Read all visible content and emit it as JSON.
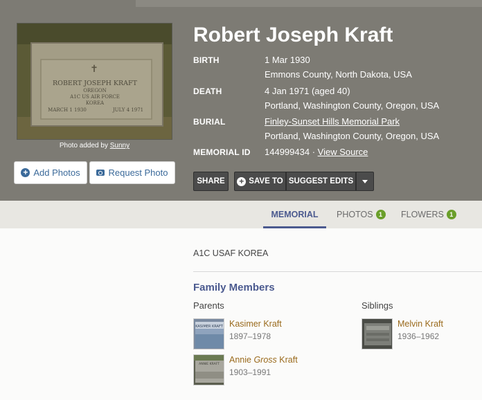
{
  "memorial": {
    "name": "Robert Joseph Kraft",
    "photo_credit_prefix": "Photo added by ",
    "photo_credit_user": "Sunny",
    "headstone_text": {
      "line1": "ROBERT JOSEPH KRAFT",
      "line2": "OREGON",
      "line3": "A1C US AIR FORCE",
      "line4": "KOREA",
      "line5_left": "MARCH 1 1930",
      "line5_right": "JULY 4 1971"
    }
  },
  "buttons": {
    "add_photos": "Add Photos",
    "request_photo": "Request Photo",
    "share": "SHARE",
    "save_to": "SAVE TO",
    "suggest_edits": "SUGGEST EDITS"
  },
  "facts": {
    "birth_label": "BIRTH",
    "birth_date": "1 Mar 1930",
    "birth_place": "Emmons County, North Dakota, USA",
    "death_label": "DEATH",
    "death_date": "4 Jan 1971 (aged 40)",
    "death_place": "Portland, Washington County, Oregon, USA",
    "burial_label": "BURIAL",
    "burial_cemetery": "Finley-Sunset Hills Memorial Park",
    "burial_place": "Portland, Washington County, Oregon, USA",
    "memorial_id_label": "MEMORIAL ID",
    "memorial_id": "144999434",
    "separator": " · ",
    "view_source": "View Source"
  },
  "tabs": {
    "memorial": "MEMORIAL",
    "photos": "PHOTOS",
    "photos_count": "1",
    "flowers": "FLOWERS",
    "flowers_count": "1"
  },
  "content": {
    "inscription": "A1C USAF KOREA",
    "family_heading": "Family Members",
    "parents_label": "Parents",
    "siblings_label": "Siblings",
    "parents": [
      {
        "name": "Kasimer Kraft",
        "dates": "1897–1978",
        "thumb_text": "KASIMER KRAFT"
      },
      {
        "first": "Annie ",
        "maiden": "Gross",
        "last": " Kraft",
        "dates": "1903–1991",
        "thumb_text": "ANNIE KRAFT"
      }
    ],
    "siblings": [
      {
        "name": "Melvin Kraft",
        "dates": "1936–1962"
      }
    ]
  },
  "colors": {
    "hero_bg": "#7d7b74",
    "link_blue": "#3b6a9a",
    "accent_purple": "#4b5a8f",
    "name_gold": "#9a6a1c",
    "badge_green": "#6a9f2a"
  },
  "icons": {
    "add_photos": "plus-circle-icon",
    "request_photo": "camera-icon",
    "save_to": "plus-circle-icon",
    "dropdown": "caret-down-icon"
  }
}
